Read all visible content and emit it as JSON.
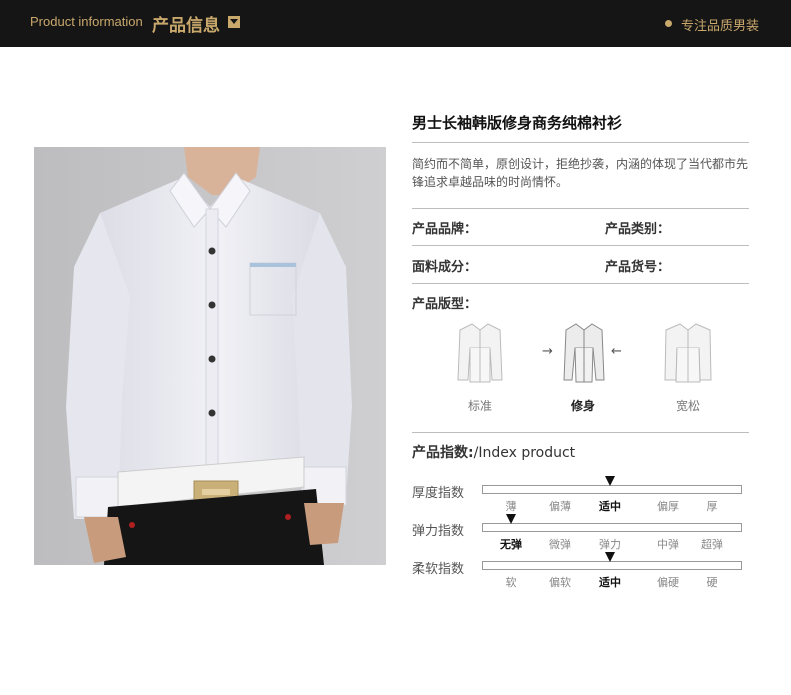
{
  "header": {
    "title_en": "Product information",
    "title_cn": "产品信息",
    "tagline": "专注品质男装",
    "colors": {
      "bar": "#151515",
      "gold": "#c9a86c"
    }
  },
  "product": {
    "title": "男士长袖韩版修身商务纯棉衬衫",
    "description": "简约而不简单，原创设计，拒绝抄袭，内涵的体现了当代都市先锋追求卓越品味的时尚情怀。",
    "fields": {
      "brand": "产品品牌：",
      "category": "产品类别：",
      "fabric": "面料成分：",
      "item_no": "产品货号："
    }
  },
  "fit": {
    "label": "产品版型：",
    "options": [
      {
        "label": "标准",
        "selected": false
      },
      {
        "label": "修身",
        "selected": true
      },
      {
        "label": "宽松",
        "selected": false
      }
    ]
  },
  "index": {
    "heading_cn": "产品指数:",
    "heading_en": "/Index product",
    "rows": [
      {
        "name": "厚度指数",
        "options": [
          "薄",
          "偏薄",
          "适中",
          "偏厚",
          "厚"
        ],
        "selected": 2
      },
      {
        "name": "弹力指数",
        "options": [
          "无弹",
          "微弹",
          "弹力",
          "中弹",
          "超弹"
        ],
        "selected": 0
      },
      {
        "name": "柔软指数",
        "options": [
          "软",
          "偏软",
          "适中",
          "偏硬",
          "硬"
        ],
        "selected": 2
      }
    ]
  }
}
